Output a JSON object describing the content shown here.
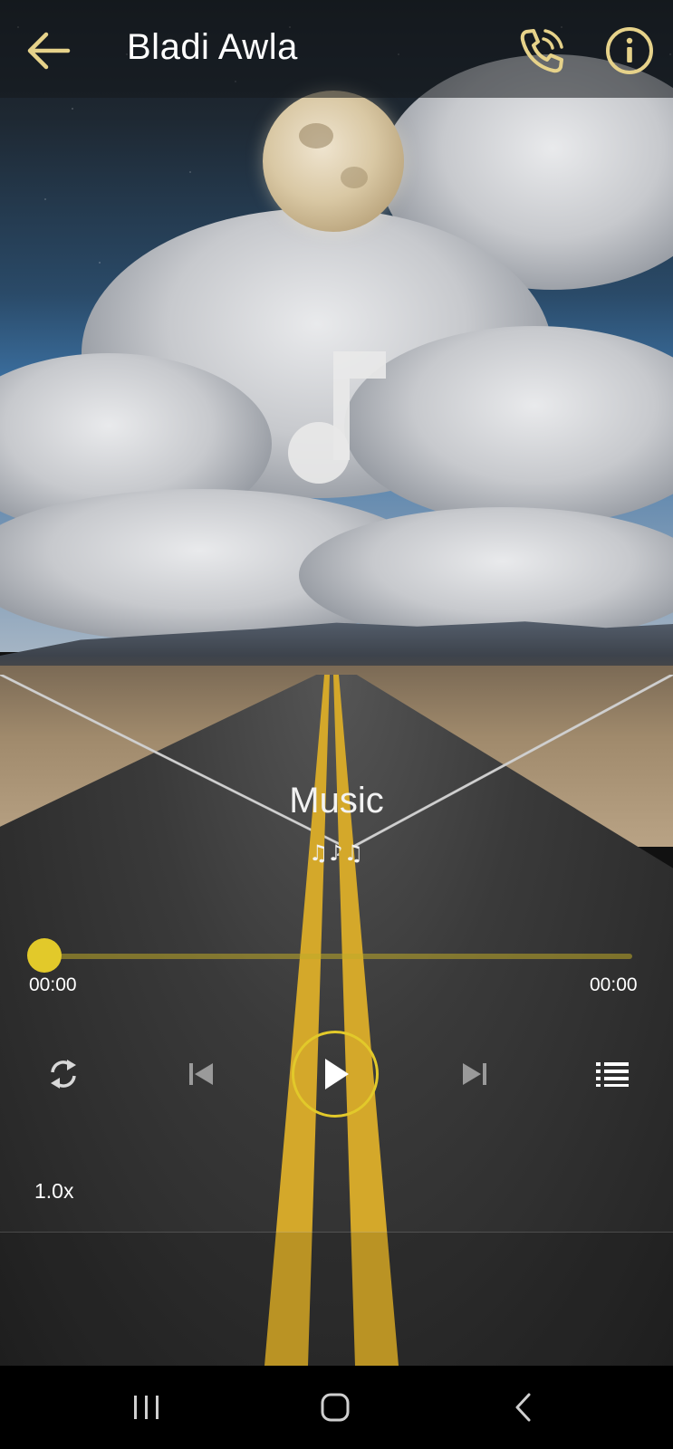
{
  "header": {
    "title": "Bladi Awla",
    "back_icon": "arrow-left-icon",
    "call_icon": "phone-ringing-icon",
    "info_icon": "info-circle-icon"
  },
  "artwork": {
    "icon": "music-note-icon"
  },
  "track": {
    "title": "Music",
    "subtitle": "♫♪♫"
  },
  "progress": {
    "elapsed": "00:00",
    "total": "00:00",
    "fraction": 0
  },
  "controls": {
    "repeat_icon": "repeat-icon",
    "previous_icon": "skip-previous-icon",
    "play_icon": "play-icon",
    "next_icon": "skip-next-icon",
    "playlist_icon": "playlist-icon"
  },
  "speed": {
    "label": "1.0x"
  },
  "system_nav": {
    "recents_icon": "recents-icon",
    "home_icon": "home-icon",
    "back_icon": "back-chevron-icon"
  },
  "colors": {
    "accent": "#E2C92A",
    "header_icon": "#E6D28A",
    "text": "#FFFFFF"
  }
}
